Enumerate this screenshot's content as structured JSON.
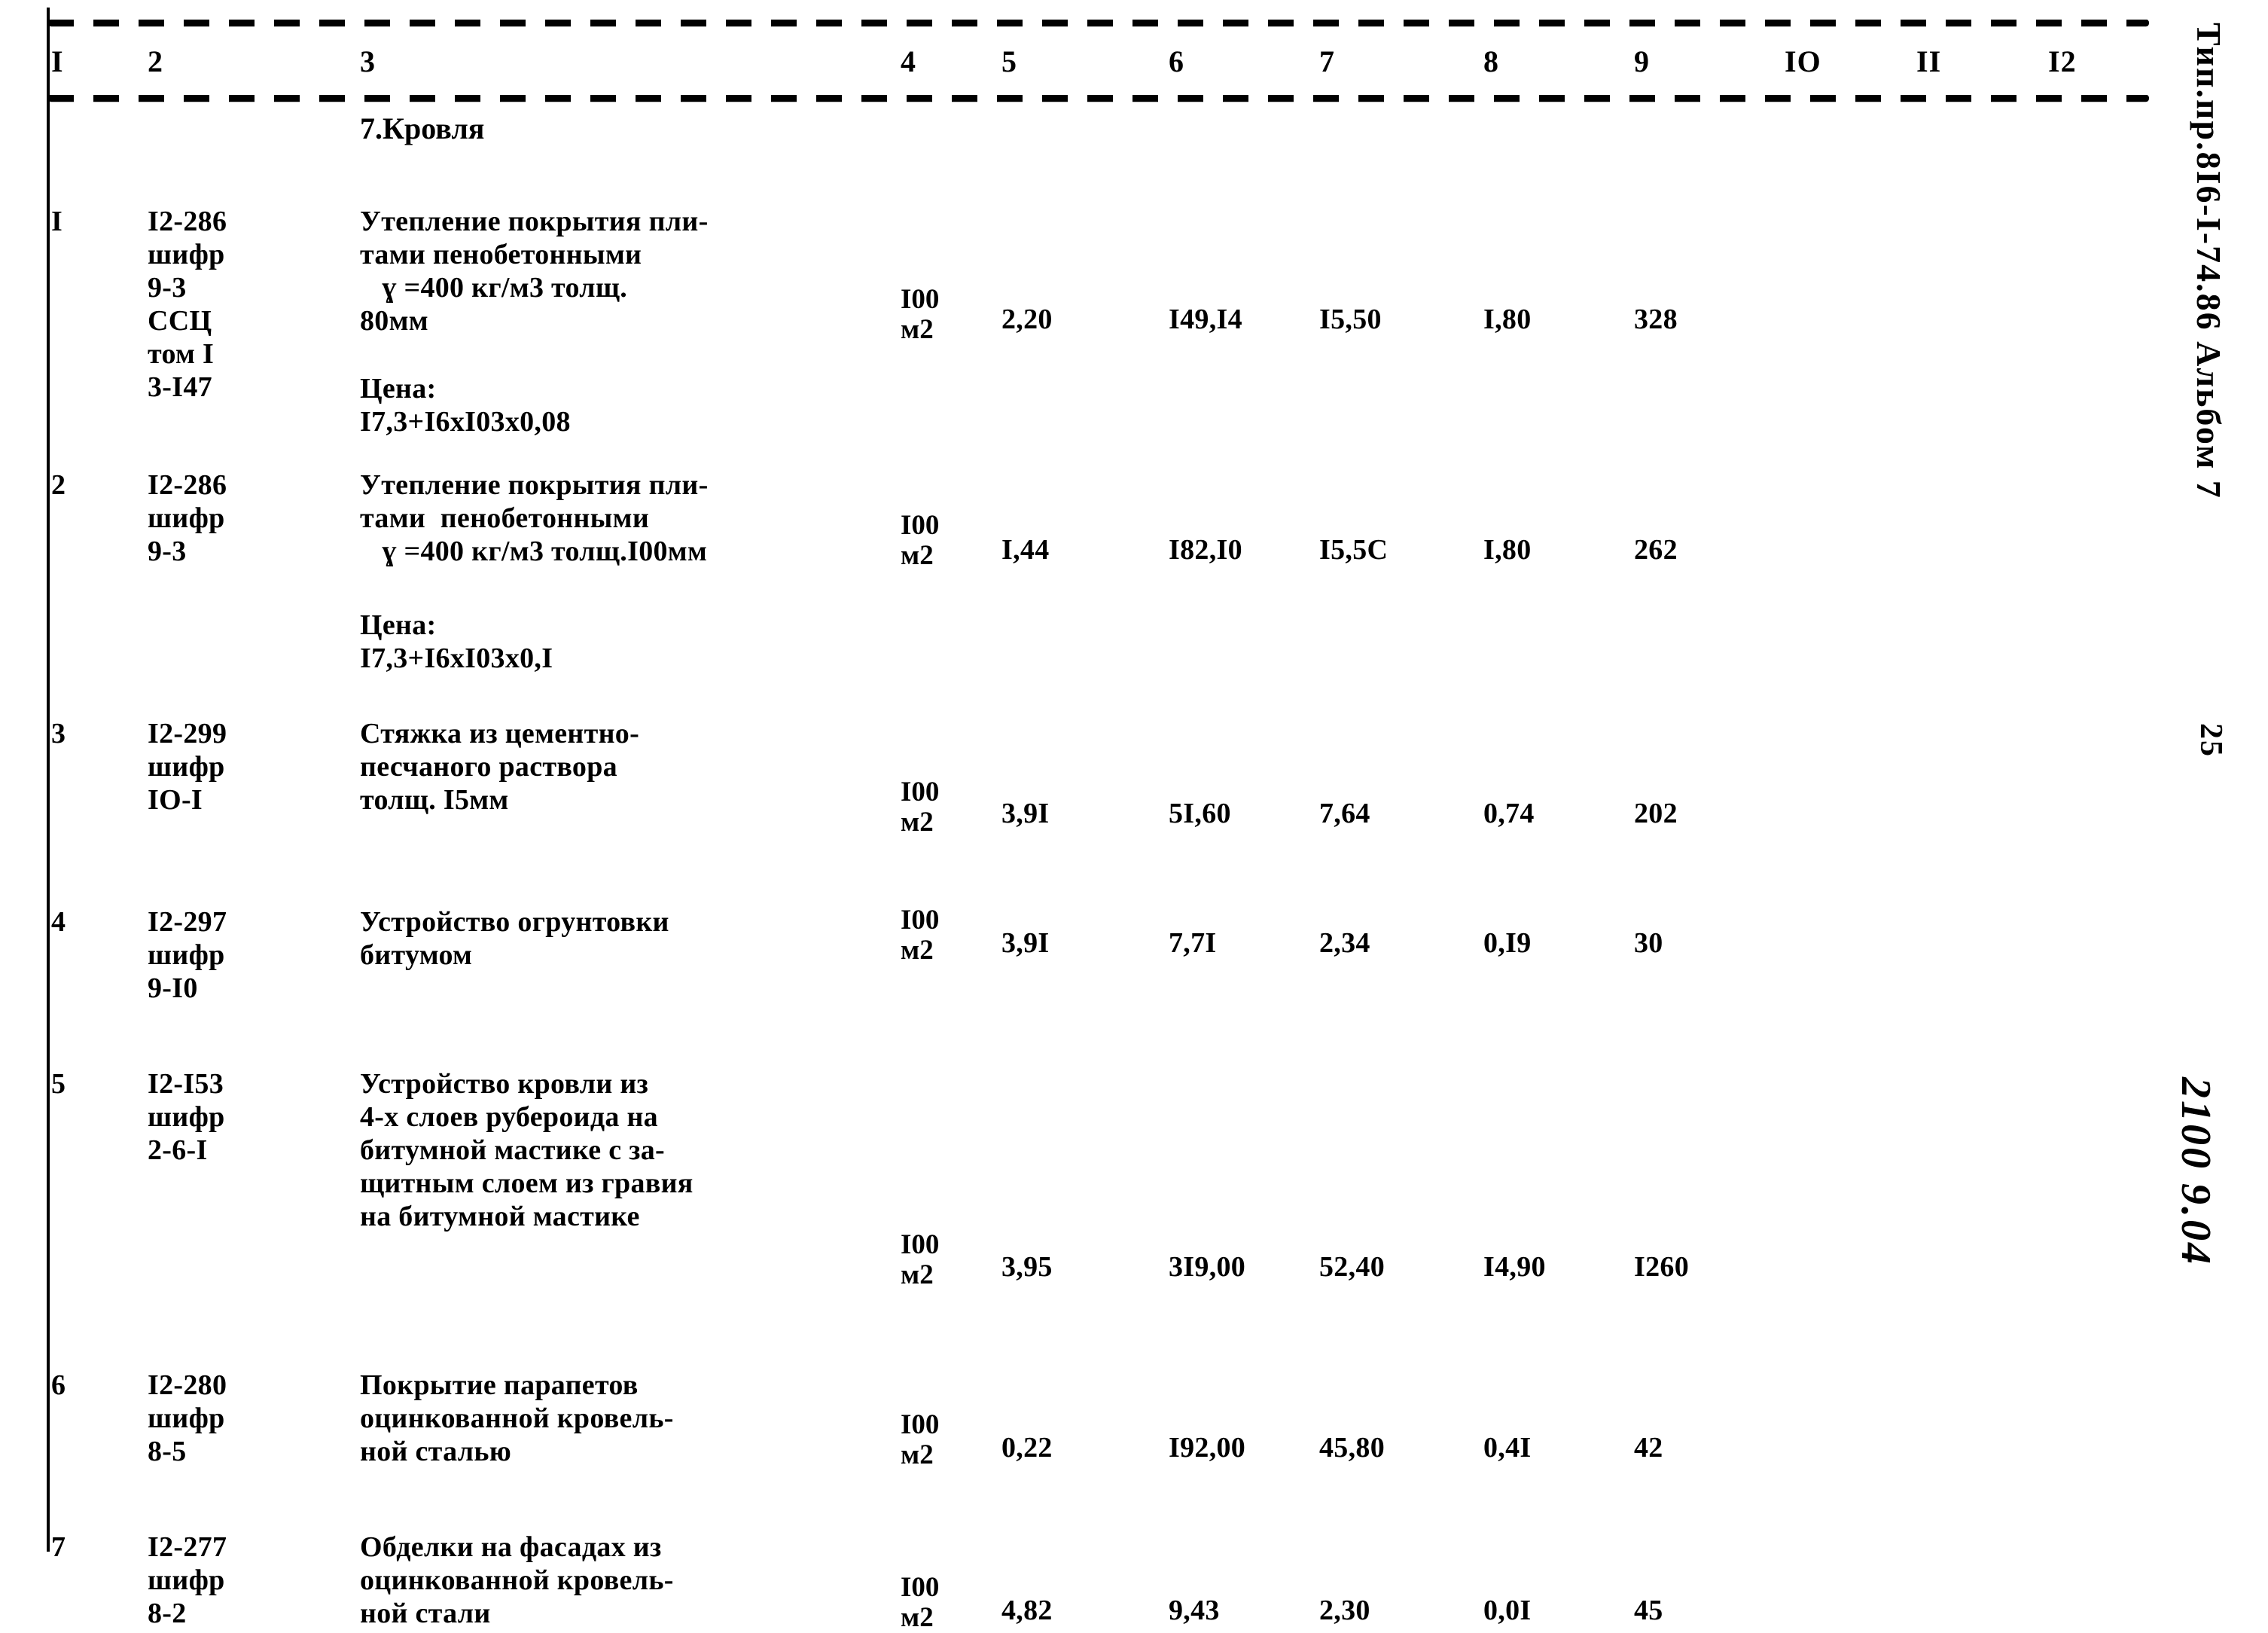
{
  "document": {
    "kind": "scanned-typewritten-estimate-table",
    "background_color": "#fdfdfb",
    "ink_color": "#0a0a0a"
  },
  "header": {
    "columns": [
      "I",
      "2",
      "3",
      "4",
      "5",
      "6",
      "7",
      "8",
      "9",
      "IO",
      "II",
      "I2"
    ],
    "column_x": [
      68,
      196,
      478,
      1196,
      1330,
      1552,
      1752,
      1970,
      2170,
      2370,
      2545,
      2720
    ]
  },
  "section": {
    "title": "7.Кровля"
  },
  "rows": [
    {
      "no": "I",
      "code": "I2-286\nшифр\n9-3\nССЦ\nтом I\n3-I47",
      "description": "Утепление покрытия пли-\nтами пенобетонными\n   ɣ =400 кг/м3 толщ.\n80мм",
      "price_note": "Цена:\nI7,3+I6хI03х0,08",
      "unit": "I00\nм2",
      "c5": "2,20",
      "c6": "I49,I4",
      "c7": "I5,50",
      "c8": "I,80",
      "c9": "328"
    },
    {
      "no": "2",
      "code": "I2-286\nшифр\n9-3",
      "description": "Утепление покрытия пли-\nтами  пенобетонными\n   ɣ =400 кг/м3 толщ.I00мм",
      "price_note": "Цена:\nI7,3+I6хI03х0,I",
      "unit": "I00\nм2",
      "c5": "I,44",
      "c6": "I82,I0",
      "c7": "I5,5С",
      "c8": "I,80",
      "c9": "262"
    },
    {
      "no": "3",
      "code": "I2-299\nшифр\nIO-I",
      "description": "Стяжка из цементно-\nпесчаного раствора\nтолщ. I5мм",
      "price_note": "",
      "unit": "I00\nм2",
      "c5": "3,9I",
      "c6": "5I,60",
      "c7": "7,64",
      "c8": "0,74",
      "c9": "202"
    },
    {
      "no": "4",
      "code": "I2-297\nшифр\n9-I0",
      "description": "Устройство огрунтовки\nбитумом",
      "price_note": "",
      "unit": "I00\nм2",
      "c5": "3,9I",
      "c6": "7,7I",
      "c7": "2,34",
      "c8": "0,I9",
      "c9": "30"
    },
    {
      "no": "5",
      "code": "I2-I53\nшифр\n2-6-I",
      "description": "Устройство кровли из\n4-х слоев рубероида на\nбитумной мастике с за-\nщитным слоем из гравия\nна битумной мастике",
      "price_note": "",
      "unit": "I00\nм2",
      "c5": "3,95",
      "c6": "3I9,00",
      "c7": "52,40",
      "c8": "I4,90",
      "c9": "I260"
    },
    {
      "no": "6",
      "code": "I2-280\nшифр\n8-5",
      "description": "Покрытие парапетов\nоцинкованной кровель-\nной сталью",
      "price_note": "",
      "unit": "I00\nм2",
      "c5": "0,22",
      "c6": "I92,00",
      "c7": "45,80",
      "c8": "0,4I",
      "c9": "42"
    },
    {
      "no": "7",
      "code": "I2-277\nшифр\n8-2",
      "description": "Обделки на фасадах из\nоцинкованной кровель-\nной стали",
      "price_note": "",
      "unit": "I00\nм2",
      "c5": "4,82",
      "c6": "9,43",
      "c7": "2,30",
      "c8": "0,0I",
      "c9": "45"
    }
  ],
  "margin_stamps": {
    "project_code": "Тип.пр.8I6-I-74.86  Альбом 7",
    "page_number": "25",
    "handwritten": "2100 9.04"
  }
}
